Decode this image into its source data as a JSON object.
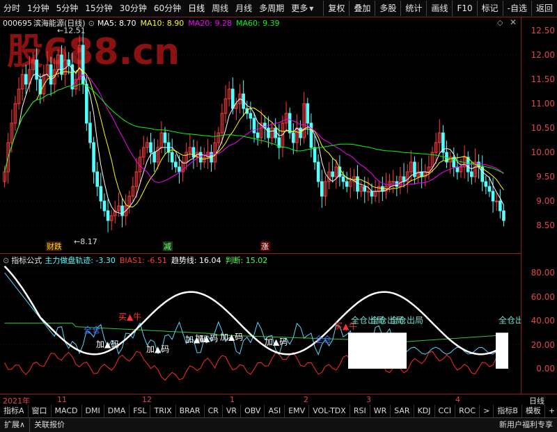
{
  "topbar": {
    "periods": [
      "分时",
      "1分钟",
      "5分钟",
      "15分钟",
      "30分钟",
      "60分钟",
      "日线",
      "周线",
      "月线",
      "多周期",
      "更多"
    ],
    "selected": "日线",
    "tools": [
      "复权",
      "叠加",
      "多股",
      "统计",
      "画线",
      "F10",
      "标记",
      "-自选",
      "返回"
    ]
  },
  "kpanel": {
    "code": "000695",
    "name": "滨海能源(日线)",
    "ma5_label": "MA5: 8.70",
    "ma10_label": "MA10: 8.90",
    "ma20_label": "MA20: 9.28",
    "ma60_label": "MA60: 9.39",
    "watermark": "股688.cn",
    "high_mark": "12.51",
    "low_mark": "8.17",
    "markers": [
      "财跌",
      "减",
      "涨"
    ],
    "yticks": [
      "12.50",
      "12.00",
      "11.50",
      "11.00",
      "10.50",
      "10.00",
      "9.50",
      "9.00",
      "8.50"
    ]
  },
  "ipanel": {
    "title": "指标公式",
    "l1": "主力做盘轨迹: -3.30",
    "l2": "BIAS1: -6.51",
    "l3": "趋势线: 16.04",
    "l4": "判断: 15.02",
    "yticks": [
      "80.00",
      "60.00",
      "40.00",
      "20.00",
      "0.00"
    ],
    "labels": {
      "buy1": "买▲牛",
      "buy2": "买▲牛",
      "add": "加▲码",
      "quanc": "全仓",
      "sell": "全仓出局"
    }
  },
  "dates": [
    "2021年",
    "11",
    "12",
    "1",
    "2",
    "3",
    "4"
  ],
  "period_label": "日线",
  "indtabs": [
    "指标A",
    "窗口",
    "MACD",
    "DMI",
    "DMA",
    "FSL",
    "TRIX",
    "BRAR",
    "CR",
    "VR",
    "OBV",
    "ASI",
    "EMV",
    "VOL-TDX",
    "RSI",
    "WR",
    "SAR",
    "KDJ",
    "CCI",
    "ROC",
    ">",
    "指标B",
    "模板",
    "+",
    "-"
  ],
  "bottom": {
    "left": [
      "扩展∧",
      "关联报价"
    ],
    "right": "新用户福利专享"
  },
  "colors": {
    "up": "#ff3c3c",
    "down": "#54ffff",
    "ma5": "#ffffff",
    "ma10": "#ffff00",
    "ma20": "#ff00ff",
    "ma60": "#00ff00"
  }
}
